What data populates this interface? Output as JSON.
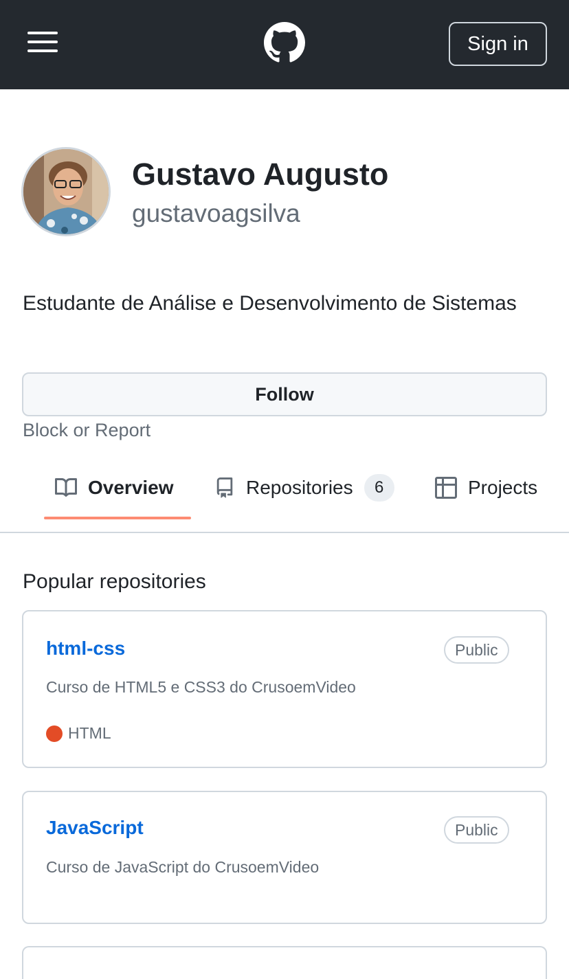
{
  "header": {
    "sign_in_label": "Sign in"
  },
  "profile": {
    "full_name": "Gustavo Augusto",
    "username": "gustavoagsilva",
    "bio": "Estudante de Análise e Desenvolvimento de Sistemas",
    "follow_label": "Follow",
    "block_label": "Block or Report"
  },
  "tabs": [
    {
      "label": "Overview",
      "icon": "book-icon",
      "active": true
    },
    {
      "label": "Repositories",
      "icon": "repo-icon",
      "count": "6"
    },
    {
      "label": "Projects",
      "icon": "table-icon"
    }
  ],
  "popular": {
    "title": "Popular repositories",
    "repos": [
      {
        "name": "html-css",
        "visibility": "Public",
        "description": "Curso de HTML5 e CSS3 do CrusoemVideo",
        "language": "HTML",
        "language_color": "#e34c26"
      },
      {
        "name": "JavaScript",
        "visibility": "Public",
        "description": "Curso de JavaScript do CrusoemVideo"
      }
    ]
  },
  "colors": {
    "header_bg": "#24292f",
    "link": "#0969da",
    "tab_underline": "#fd8c73",
    "muted": "#636c76"
  }
}
